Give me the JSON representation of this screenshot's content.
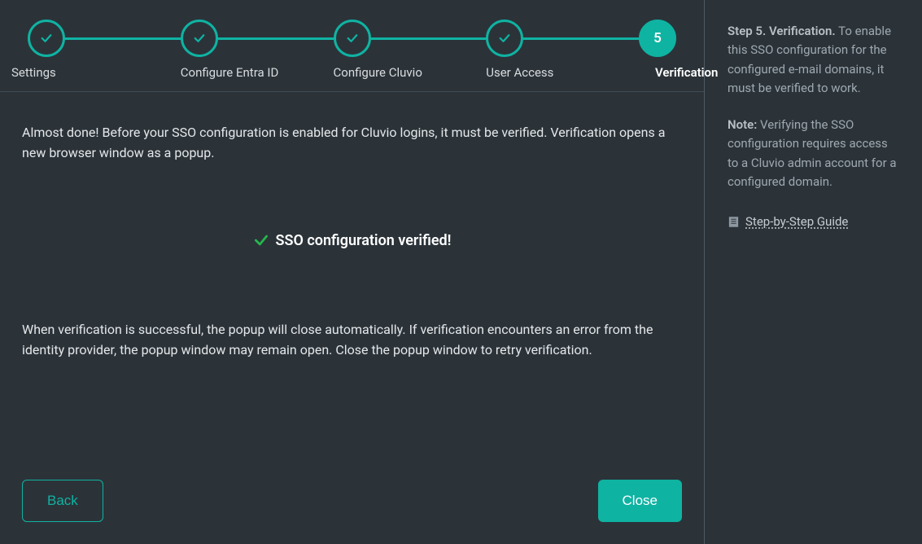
{
  "steps": [
    {
      "label": "Settings",
      "state": "done"
    },
    {
      "label": "Configure Entra ID",
      "state": "done"
    },
    {
      "label": "Configure Cluvio",
      "state": "done"
    },
    {
      "label": "User Access",
      "state": "done"
    },
    {
      "label": "Verification",
      "state": "active",
      "num": "5"
    }
  ],
  "main": {
    "para1": "Almost done! Before your SSO configuration is enabled for Cluvio logins, it must be verified. Verification opens a new browser window as a popup.",
    "verified": "SSO configuration verified!",
    "para2": "When verification is successful, the popup will close automatically. If verification encounters an error from the identity provider, the popup window may remain open. Close the popup window to retry verification."
  },
  "footer": {
    "back": "Back",
    "close": "Close"
  },
  "side": {
    "strong1": "Step 5. Verification.",
    "text1": " To enable this SSO configuration for the configured e-mail domains, it must be verified to work.",
    "strong2": "Note:",
    "text2": " Verifying the SSO configuration requires access to a Cluvio admin account for a configured domain.",
    "guide": "Step-by-Step Guide"
  }
}
